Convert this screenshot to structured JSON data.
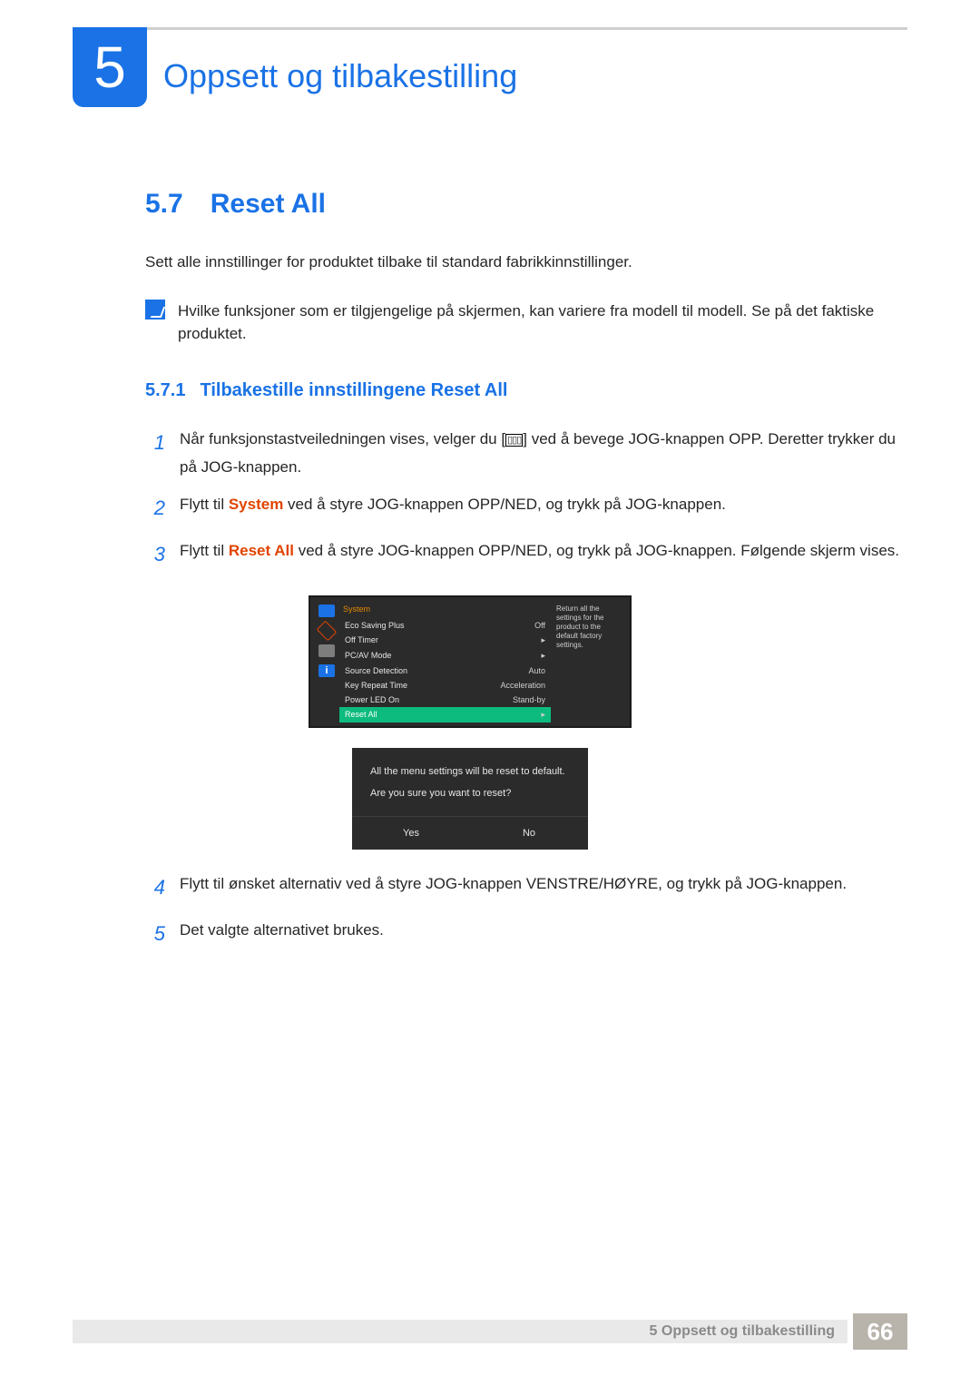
{
  "chapter": {
    "number": "5",
    "title": "Oppsett og tilbakestilling"
  },
  "section": {
    "number": "5.7",
    "title": "Reset All"
  },
  "intro": "Sett alle innstillinger for produktet tilbake til standard fabrikkinnstillinger.",
  "note": "Hvilke funksjoner som er tilgjengelige på skjermen, kan variere fra modell til modell. Se på det faktiske produktet.",
  "subsection": {
    "number": "5.7.1",
    "title": "Tilbakestille innstillingene Reset All"
  },
  "steps": {
    "s1a": "Når funksjonstastveiledningen vises, velger du [",
    "s1b": "] ved å bevege JOG-knappen OPP. Deretter trykker du på JOG-knappen.",
    "s2a": "Flytt til ",
    "s2strong": "System",
    "s2b": " ved å styre JOG-knappen OPP/NED, og trykk på JOG-knappen.",
    "s3a": "Flytt til ",
    "s3strong": "Reset All",
    "s3b": " ved å styre JOG-knappen OPP/NED, og trykk på JOG-knappen. Følgende skjerm vises.",
    "s4": "Flytt til ønsket alternativ ved å styre JOG-knappen VENSTRE/HØYRE, og trykk på JOG-knappen.",
    "s5": "Det valgte alternativet brukes."
  },
  "osd": {
    "caption": "System",
    "rows": [
      {
        "label": "Eco Saving Plus",
        "value": "Off"
      },
      {
        "label": "Off Timer",
        "value": "▸"
      },
      {
        "label": "PC/AV Mode",
        "value": "▸"
      },
      {
        "label": "Source Detection",
        "value": "Auto"
      },
      {
        "label": "Key Repeat Time",
        "value": "Acceleration"
      },
      {
        "label": "Power LED On",
        "value": "Stand-by"
      },
      {
        "label": "Reset All",
        "value": "▸",
        "selected": true
      }
    ],
    "tip": "Return all the settings for the product to the default factory settings."
  },
  "dialog": {
    "line1": "All the menu settings will be reset to default.",
    "line2": "Are you sure you want to reset?",
    "yes": "Yes",
    "no": "No"
  },
  "footer": {
    "label": "5 Oppsett og tilbakestilling",
    "page": "66"
  }
}
